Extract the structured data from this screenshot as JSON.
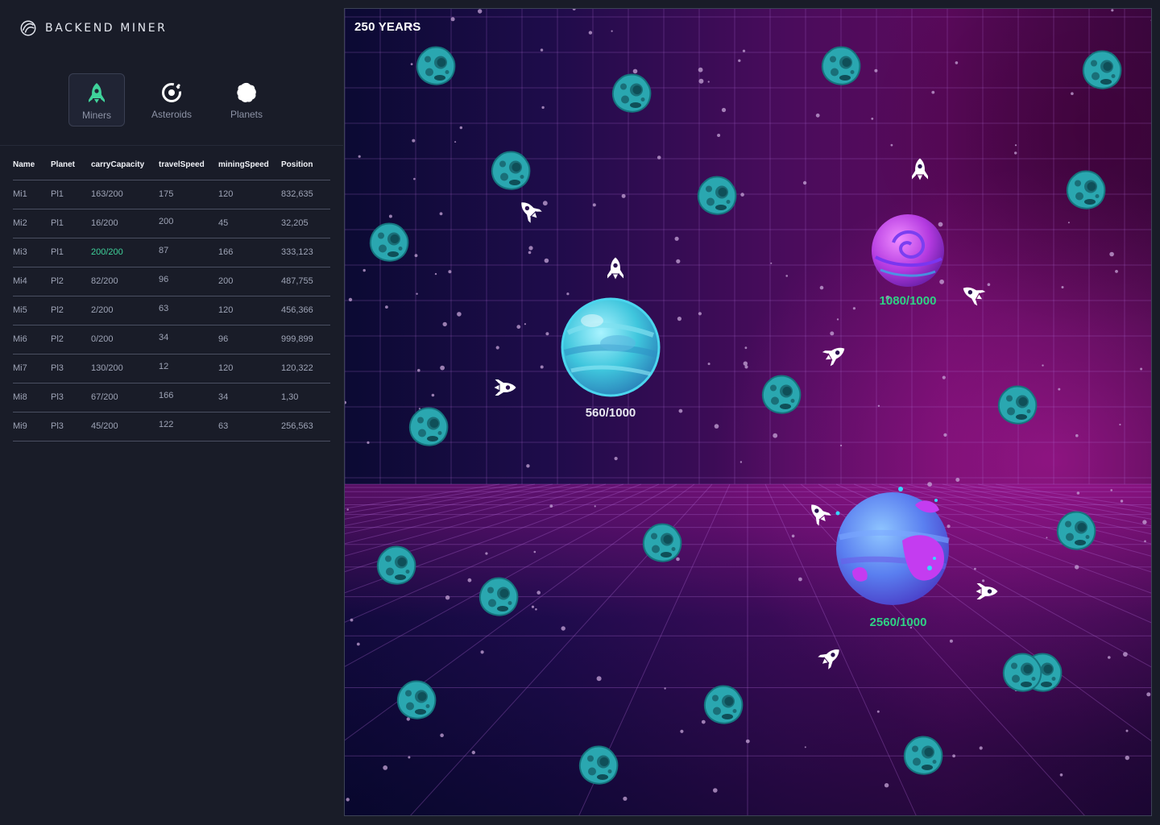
{
  "brand": {
    "title": "BACKEND MINER"
  },
  "tabs": [
    {
      "label": "Miners",
      "icon": "rocket-icon",
      "active": true
    },
    {
      "label": "Asteroids",
      "icon": "asteroid-icon",
      "active": false
    },
    {
      "label": "Planets",
      "icon": "planet-icon",
      "active": false
    }
  ],
  "table": {
    "headers": [
      "Name",
      "Planet",
      "carryCapacity",
      "travelSpeed",
      "miningSpeed",
      "Position"
    ],
    "rows": [
      [
        "Mi1",
        "Pl1",
        "163/200",
        "175",
        "120",
        "832,635"
      ],
      [
        "Mi2",
        "Pl1",
        "16/200",
        "200",
        "45",
        "32,205"
      ],
      [
        "Mi3",
        "Pl1",
        "200/200",
        "87",
        "166",
        "333,123"
      ],
      [
        "Mi4",
        "Pl2",
        "82/200",
        "96",
        "200",
        "487,755"
      ],
      [
        "Mi5",
        "Pl2",
        "2/200",
        "63",
        "120",
        "456,366"
      ],
      [
        "Mi6",
        "Pl2",
        "0/200",
        "34",
        "96",
        "999,899"
      ],
      [
        "Mi7",
        "Pl3",
        "130/200",
        "12",
        "120",
        "120,322"
      ],
      [
        "Mi8",
        "Pl3",
        "67/200",
        "166",
        "34",
        "1,30"
      ],
      [
        "Mi9",
        "Pl3",
        "45/200",
        "122",
        "63",
        "256,563"
      ]
    ]
  },
  "game": {
    "years_label": "250 YEARS",
    "planets": [
      {
        "label": "560/1000",
        "color": "#e8e8f0",
        "style": "cyan"
      },
      {
        "label": "1080/1000",
        "color": "#2fd184",
        "style": "magenta"
      },
      {
        "label": "2560/1000",
        "color": "#2fd184",
        "style": "blue-purple"
      }
    ],
    "asteroid_count": 24,
    "miner_count": 9
  },
  "colors": {
    "accent_green": "#3fd29a",
    "progress_green": "#2fd184",
    "sidebar_bg": "#191c28",
    "asteroid": "#2aa7b0"
  }
}
